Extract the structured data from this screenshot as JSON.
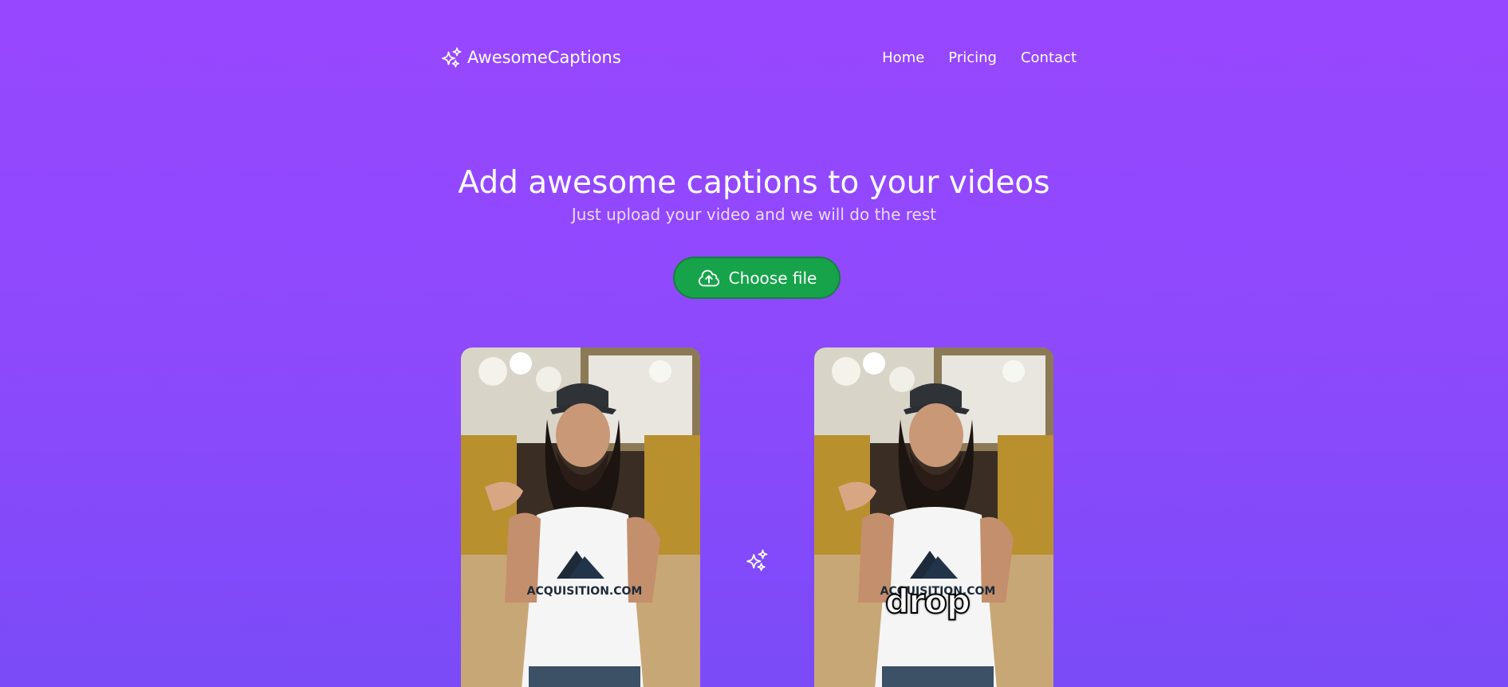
{
  "brand": {
    "name": "AwesomeCaptions",
    "icon": "sparkles-icon"
  },
  "nav": {
    "home": "Home",
    "pricing": "Pricing",
    "contact": "Contact"
  },
  "hero": {
    "title": "Add awesome captions to your videos",
    "subtitle": "Just upload your video and we will do the rest"
  },
  "upload": {
    "button_label": "Choose file",
    "icon": "cloud-upload-icon"
  },
  "demo": {
    "caption_word": "drop",
    "center_icon": "sparkles-icon",
    "shirt_text": "ACQUISITION.COM"
  },
  "colors": {
    "background_top": "#9747FF",
    "background_bottom": "#7B4BF8",
    "button_green": "#16a34a"
  }
}
